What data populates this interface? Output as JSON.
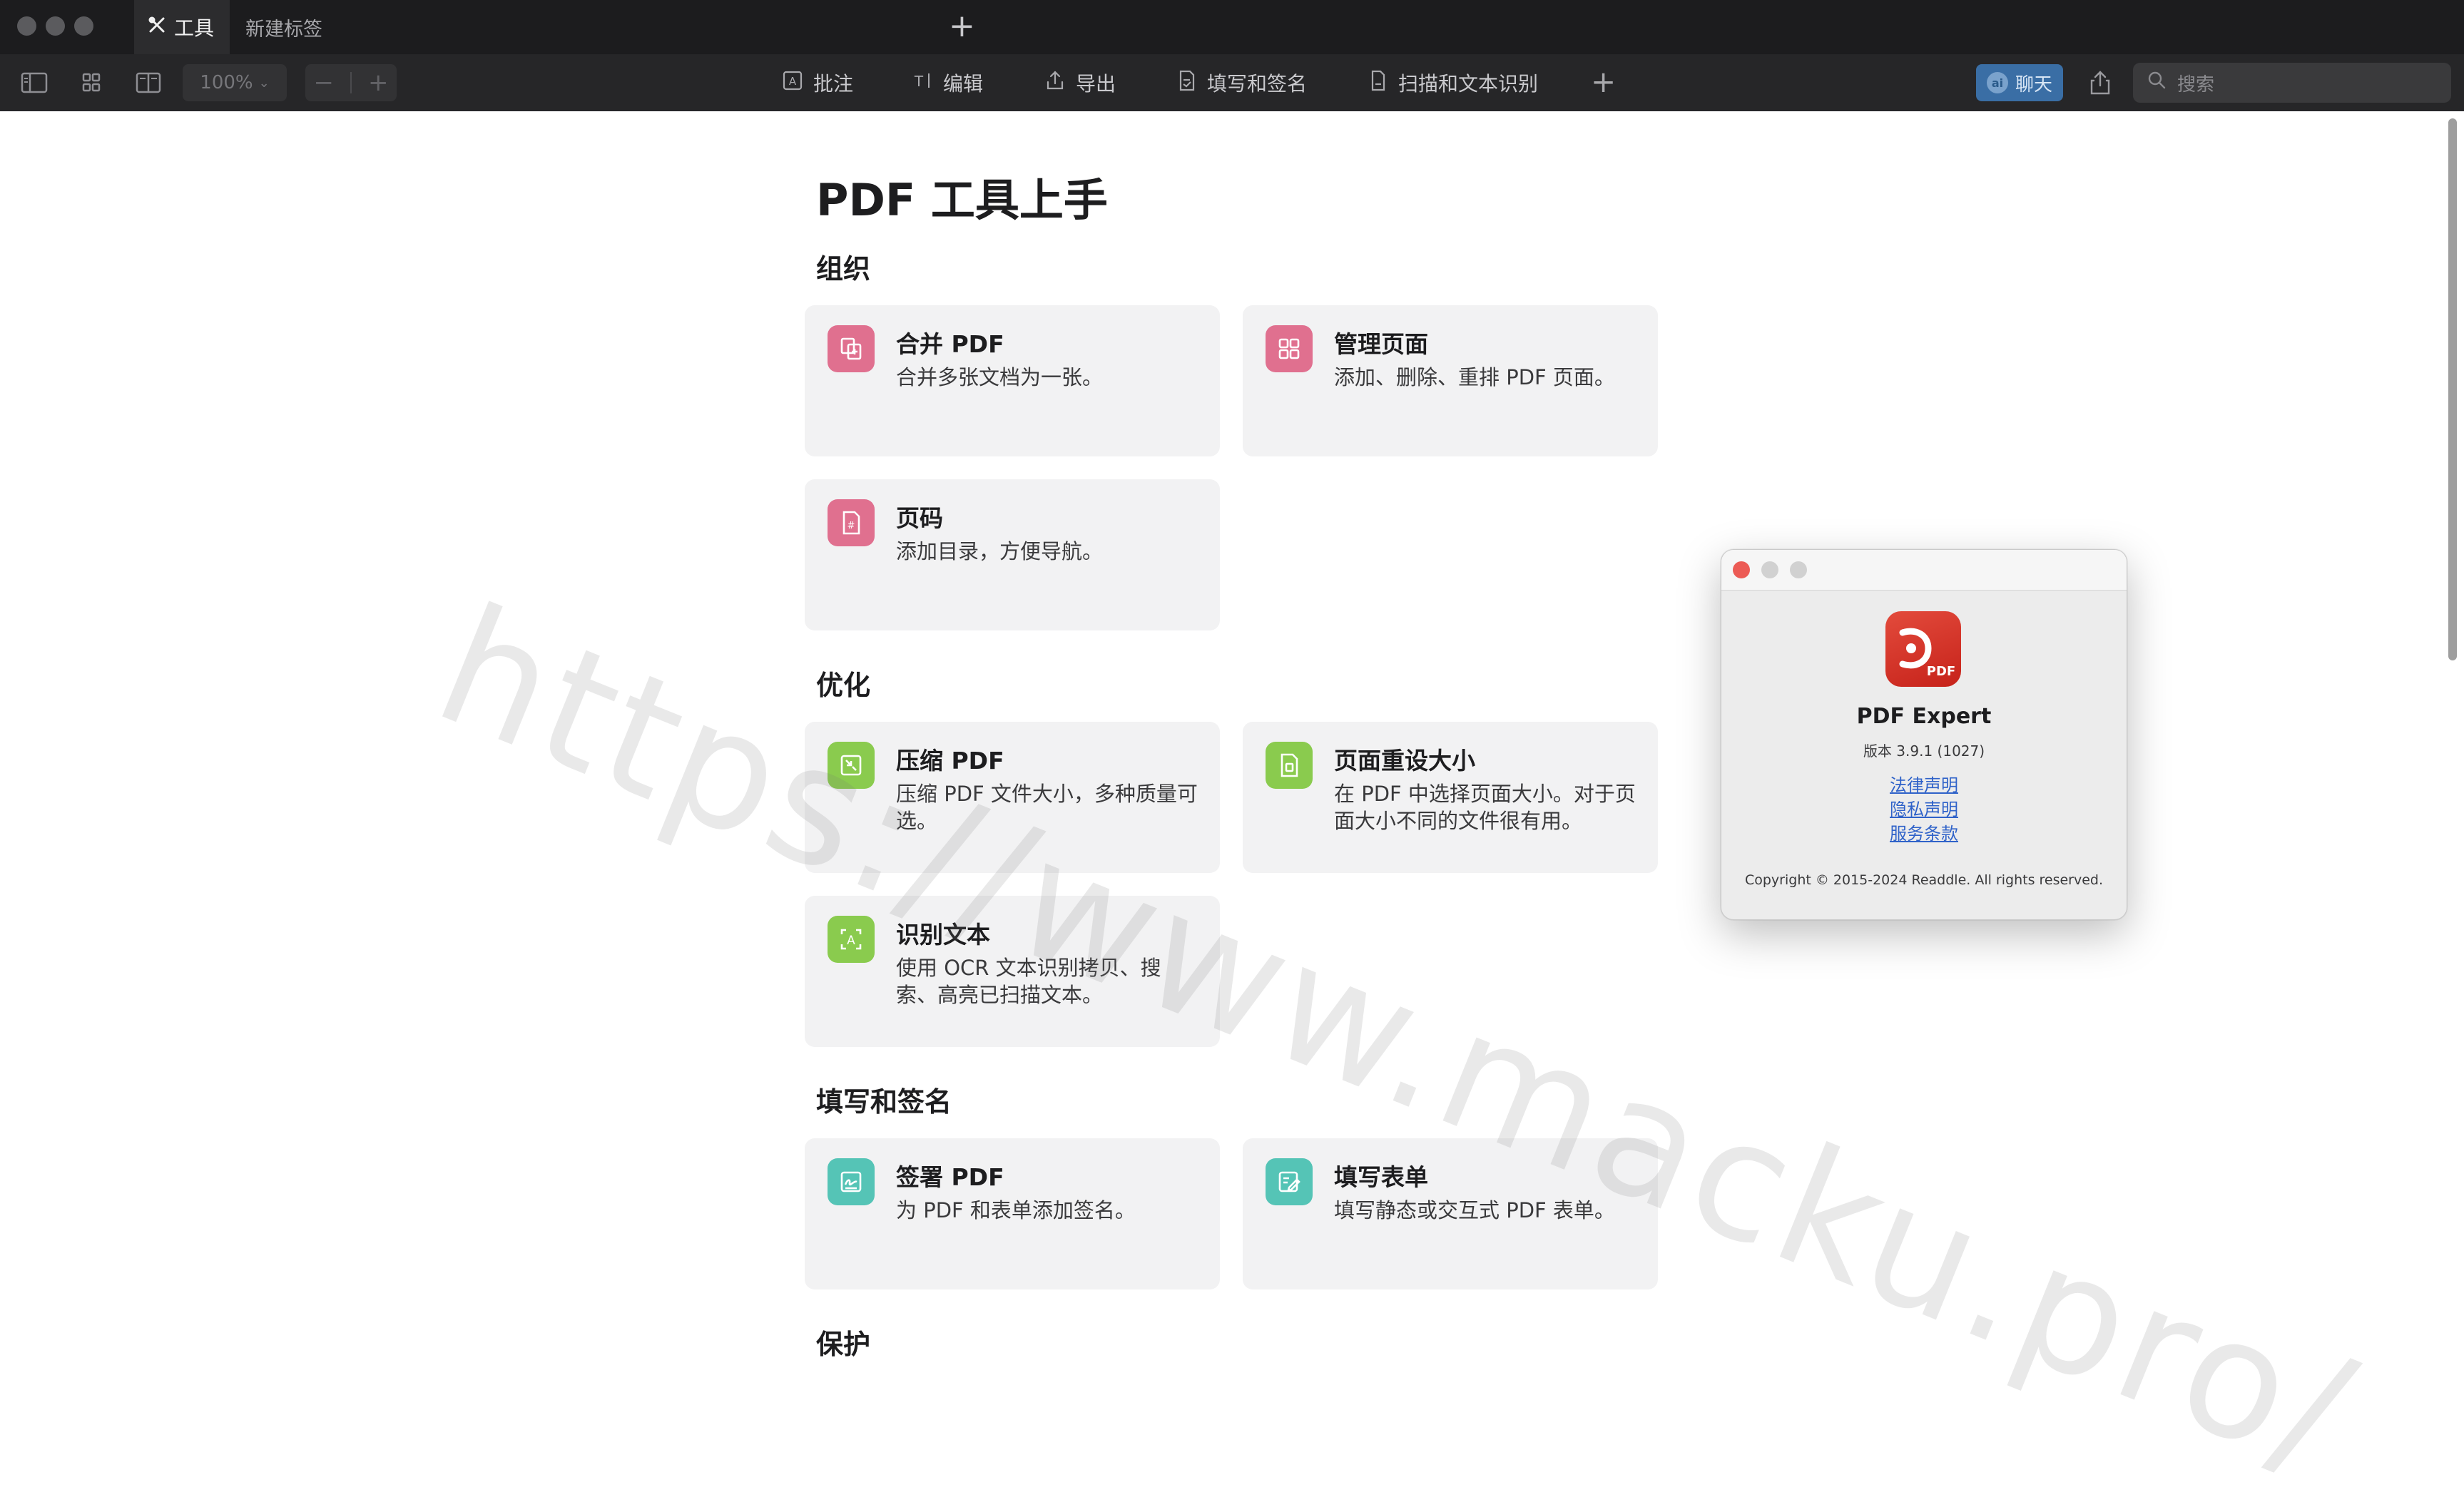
{
  "colors": {
    "organize_icon": "#e0708f",
    "optimize_icon": "#8acb4e",
    "fill_sign_icon": "#55c4b6",
    "link": "#2f62c9",
    "chat_button": "#3a6ea5"
  },
  "tabs": [
    {
      "label": "工具",
      "icon": "tools-icon",
      "active": true
    },
    {
      "label": "新建标签",
      "active": false
    }
  ],
  "toolbar": {
    "zoom_value": "100%",
    "tools": [
      {
        "label": "批注",
        "icon": "annotate-icon"
      },
      {
        "label": "编辑",
        "icon": "edit-text-icon"
      },
      {
        "label": "导出",
        "icon": "export-icon"
      },
      {
        "label": "填写和签名",
        "icon": "fill-sign-icon"
      },
      {
        "label": "扫描和文本识别",
        "icon": "scan-icon"
      }
    ],
    "chat_label": "聊天",
    "search_placeholder": "搜索"
  },
  "main": {
    "title": "PDF 工具上手",
    "sections": [
      {
        "title": "组织",
        "cards": [
          {
            "title": "合并 PDF",
            "desc": "合并多张文档为一张。",
            "icon": "merge-icon"
          },
          {
            "title": "管理页面",
            "desc": "添加、删除、重排 PDF 页面。",
            "icon": "grid-pages-icon"
          },
          {
            "title": "页码",
            "desc": "添加目录，方便导航。",
            "icon": "page-number-icon"
          }
        ]
      },
      {
        "title": "优化",
        "cards": [
          {
            "title": "压缩 PDF",
            "desc": "压缩 PDF 文件大小，多种质量可选。",
            "icon": "compress-icon"
          },
          {
            "title": "页面重设大小",
            "desc": "在 PDF 中选择页面大小。对于页面大小不同的文件很有用。",
            "icon": "resize-page-icon"
          },
          {
            "title": "识别文本",
            "desc": "使用 OCR 文本识别拷贝、搜索、高亮已扫描文本。",
            "icon": "ocr-icon"
          }
        ]
      },
      {
        "title": "填写和签名",
        "cards": [
          {
            "title": "签署 PDF",
            "desc": "为 PDF 和表单添加签名。",
            "icon": "signature-icon"
          },
          {
            "title": "填写表单",
            "desc": "填写静态或交互式 PDF 表单。",
            "icon": "form-fill-icon"
          }
        ]
      },
      {
        "title": "保护",
        "cards": []
      }
    ]
  },
  "watermark": "https://www.macku.pro/",
  "about_dialog": {
    "app_name": "PDF Expert",
    "logo_text": "PDF",
    "version": "版本 3.9.1 (1027)",
    "links": [
      "法律声明",
      "隐私声明",
      "服务条款"
    ],
    "copyright": "Copyright © 2015-2024 Readdle. All rights reserved."
  }
}
